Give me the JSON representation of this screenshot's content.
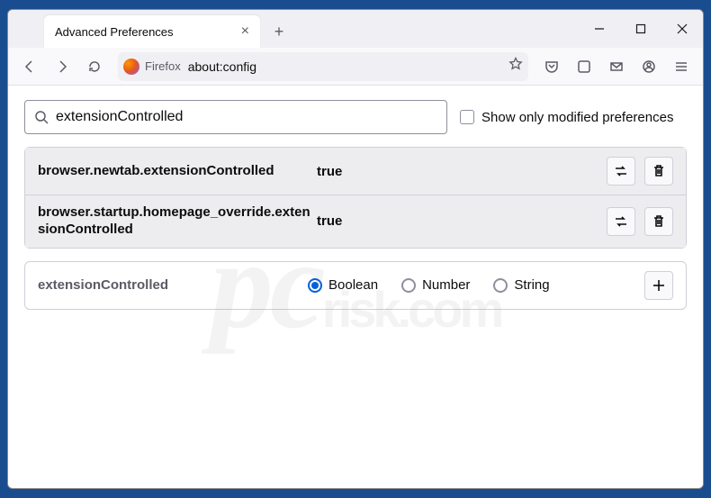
{
  "tab": {
    "title": "Advanced Preferences"
  },
  "urlbar": {
    "identity": "Firefox",
    "url": "about:config"
  },
  "search": {
    "value": "extensionControlled"
  },
  "checkbox": {
    "label": "Show only modified preferences"
  },
  "prefs": [
    {
      "name": "browser.newtab.extensionControlled",
      "value": "true"
    },
    {
      "name": "browser.startup.homepage_override.extensionControlled",
      "value": "true"
    }
  ],
  "newpref": {
    "name": "extensionControlled",
    "types": {
      "boolean": "Boolean",
      "number": "Number",
      "string": "String"
    }
  }
}
